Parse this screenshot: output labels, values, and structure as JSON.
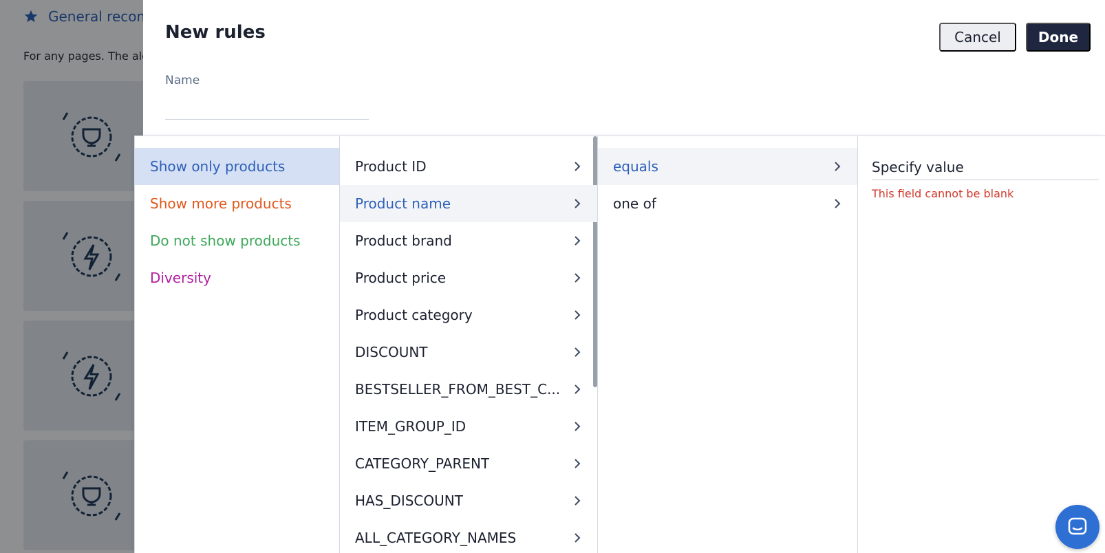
{
  "background": {
    "header_title": "General recom",
    "subtitle": "For any pages. The alg"
  },
  "drawer": {
    "title": "New rules",
    "cancel_label": "Cancel",
    "done_label": "Done",
    "name_label": "Name",
    "name_value": ""
  },
  "menu": {
    "rule_types": [
      {
        "label": "Show only products",
        "color": "#2d5fb8",
        "selected": true
      },
      {
        "label": "Show more products",
        "color": "#e0581d",
        "selected": false
      },
      {
        "label": "Do not show products",
        "color": "#3ea85a",
        "selected": false
      },
      {
        "label": "Diversity",
        "color": "#b21fa0",
        "selected": false
      }
    ],
    "fields": [
      {
        "label": "Product ID",
        "selected": false
      },
      {
        "label": "Product name",
        "selected": true
      },
      {
        "label": "Product brand",
        "selected": false
      },
      {
        "label": "Product price",
        "selected": false
      },
      {
        "label": "Product category",
        "selected": false
      },
      {
        "label": "DISCOUNT",
        "selected": false
      },
      {
        "label": "BESTSELLER_FROM_BEST_C...",
        "selected": false
      },
      {
        "label": "ITEM_GROUP_ID",
        "selected": false
      },
      {
        "label": "CATEGORY_PARENT",
        "selected": false
      },
      {
        "label": "HAS_DISCOUNT",
        "selected": false
      },
      {
        "label": "ALL_CATEGORY_NAMES",
        "selected": false
      }
    ],
    "operators": [
      {
        "label": "equals",
        "selected": true
      },
      {
        "label": "one of",
        "selected": false
      }
    ],
    "value": {
      "placeholder": "Specify value",
      "error": "This field cannot be blank"
    }
  },
  "colors": {
    "accent": "#2d5fb8",
    "primary_button": "#1f2740",
    "error": "#d03a2c",
    "chat": "#2d6fd2"
  }
}
